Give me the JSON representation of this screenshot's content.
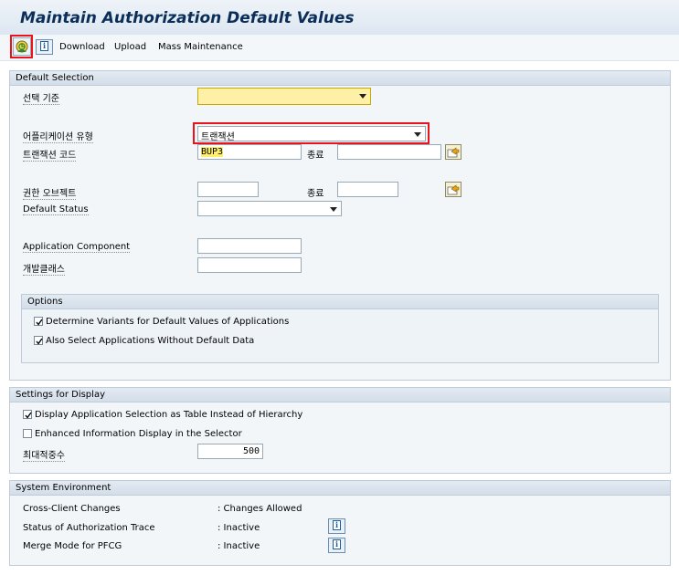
{
  "title": "Maintain Authorization Default Values",
  "toolbar": {
    "download": "Download",
    "upload": "Upload",
    "mass_maintenance": "Mass Maintenance"
  },
  "default_selection": {
    "header": "Default Selection",
    "selection_criteria_label": "선택 기준",
    "selection_criteria_value": "",
    "app_type_label": "어플리케이션 유형",
    "app_type_value": "트랜잭션",
    "tcode_label": "트랜잭션 코드",
    "tcode_value": "BUP3",
    "tcode_to_label": "종료",
    "tcode_to_value": "",
    "auth_object_label": "권한 오브젝트",
    "auth_object_value": "",
    "auth_object_to_label": "종료",
    "auth_object_to_value": "",
    "default_status_label": "Default Status",
    "default_status_value": "",
    "app_component_label": "Application Component",
    "app_component_value": "",
    "dev_class_label": "개발클래스",
    "dev_class_value": ""
  },
  "options": {
    "header": "Options",
    "items": [
      {
        "label": "Determine Variants for Default Values of Applications",
        "checked": true
      },
      {
        "label": "Also Select Applications Without Default Data",
        "checked": true
      }
    ]
  },
  "display": {
    "header": "Settings for Display",
    "items": [
      {
        "label": "Display Application Selection as Table Instead of Hierarchy",
        "checked": true
      },
      {
        "label": "Enhanced Information Display in the Selector",
        "checked": false
      }
    ],
    "max_hits_label": "최대적중수",
    "max_hits_value": "500"
  },
  "system": {
    "header": "System Environment",
    "rows": [
      {
        "label": "Cross-Client Changes",
        "value": ": Changes Allowed"
      },
      {
        "label": "Status of Authorization Trace",
        "value": ": Inactive"
      },
      {
        "label": "Merge Mode for PFCG",
        "value": ": Inactive"
      }
    ]
  },
  "colors": {
    "title_text": "#0b2e59",
    "highlight_red": "#e8131b",
    "required_field": "#fff0a8",
    "group_background": "#f3f6f9"
  }
}
